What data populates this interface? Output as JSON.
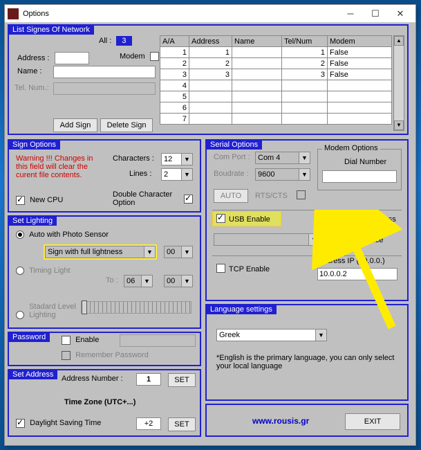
{
  "window": {
    "title": "Options"
  },
  "network": {
    "title": "List Signes Of Network",
    "all_label": "All :",
    "all_value": "3",
    "address_label": "Address :",
    "address_value": "",
    "name_label": "Name :",
    "name_value": "",
    "tel_label": "Tel. Num.:",
    "tel_value": "",
    "modem_label": "Modem",
    "add_btn": "Add Sign",
    "del_btn": "Delete Sign",
    "cols": [
      "A/A",
      "Address",
      "Name",
      "Tel/Num",
      "Modem"
    ],
    "rows": [
      [
        "1",
        "1",
        "",
        "1",
        "False"
      ],
      [
        "2",
        "2",
        "",
        "2",
        "False"
      ],
      [
        "3",
        "3",
        "",
        "3",
        "False"
      ],
      [
        "4",
        "",
        "",
        "",
        ""
      ],
      [
        "5",
        "",
        "",
        "",
        ""
      ],
      [
        "6",
        "",
        "",
        "",
        ""
      ],
      [
        "7",
        "",
        "",
        "",
        ""
      ]
    ]
  },
  "signopts": {
    "title": "Sign Options",
    "warning": "Warning !!! Changes in this field will clear the curent file contents.",
    "chars_label": "Characters :",
    "chars_value": "12",
    "lines_label": "Lines :",
    "lines_value": "2",
    "newcpu_label": "New CPU",
    "dblchar_label": "Double Character Option"
  },
  "lighting": {
    "title": "Set Lighting",
    "auto_label": "Auto with Photo Sensor",
    "fullness_value": "Sign with full lightness",
    "fullness_time": "00",
    "timing_label": "Timing Light",
    "to_label": "To :",
    "to_h": "06",
    "to_m": "00",
    "std_label": "Stadard Level Lighting"
  },
  "password": {
    "title": "Password",
    "enable_label": "Enable",
    "remember_label": "Remember Password"
  },
  "address": {
    "title": "Set Address",
    "num_label": "Address Number :",
    "num_value": "1",
    "set_btn": "SET",
    "tz_label": "Time Zone (UTC+...)",
    "dst_label": "Daylight Saving Time",
    "tz_value": "+2"
  },
  "serial": {
    "title": "Serial Options",
    "comport_label": "Com Port :",
    "comport_value": "Com 4",
    "baud_label": "Boudrate :",
    "baud_value": "9600",
    "auto_btn": "AUTO",
    "rts_label": "RTS/CTS",
    "modem_title": "Modem Options",
    "dial_label": "Dial Number",
    "dial_value": "",
    "usb_label": "USB Enable",
    "rf_label": "RF Wireless",
    "rf_selected_label": "Selected Device",
    "tcp_label": "TCP Enable",
    "ip_label": "Address IP (10.0.0.)",
    "ip_value": "10.0.0.2"
  },
  "lang": {
    "title": "Language settings",
    "value": "Greek",
    "note": "*English is the primary language, you can only select your local language"
  },
  "footer": {
    "link": "www.rousis.gr",
    "exit_btn": "EXIT"
  }
}
